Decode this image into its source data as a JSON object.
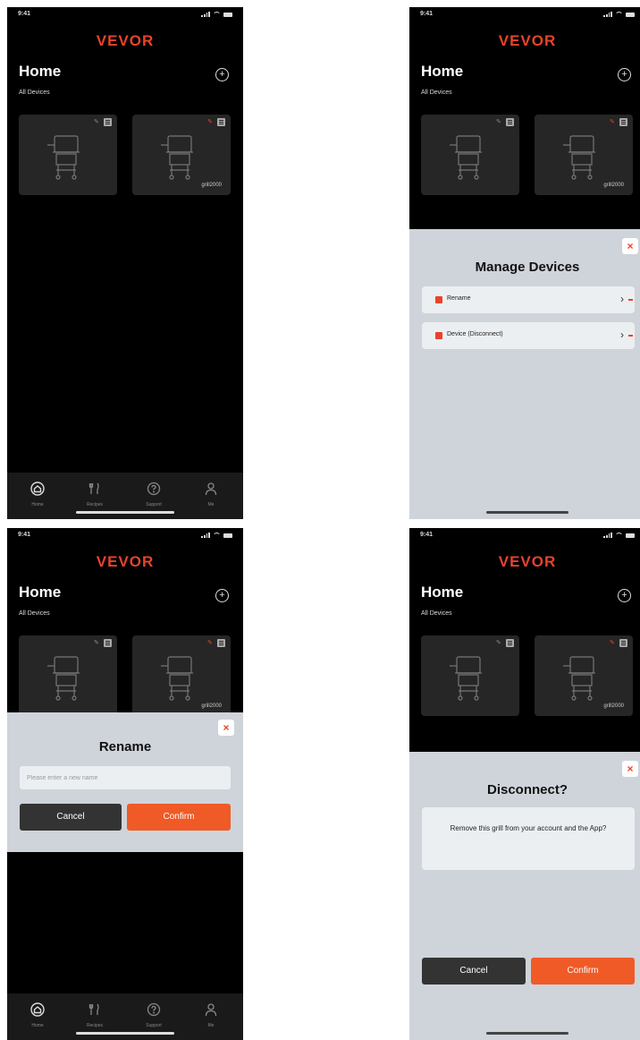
{
  "status": {
    "time": "9:41"
  },
  "brand": {
    "logo": "VEVOR",
    "accent": "#e8432b",
    "button": "#ef5a27"
  },
  "home": {
    "title": "Home",
    "subtitle": "All Devices",
    "add_icon": "plus-circle-icon",
    "devices": [
      {
        "name": ""
      },
      {
        "name": "grill2000"
      }
    ]
  },
  "tabs": [
    {
      "label": "Home",
      "icon": "home-icon"
    },
    {
      "label": "Recipes",
      "icon": "fork-knife-icon"
    },
    {
      "label": "Support",
      "icon": "help-icon"
    },
    {
      "label": "Me",
      "icon": "user-icon"
    }
  ],
  "manage": {
    "title": "Manage Devices",
    "items": [
      {
        "label": "Rename"
      },
      {
        "label": "Device (Disconnect)"
      }
    ]
  },
  "rename": {
    "title": "Rename",
    "placeholder": "Please enter a new name",
    "cancel": "Cancel",
    "confirm": "Confirm"
  },
  "disconnect": {
    "title": "Disconnect?",
    "message": "Remove this grill from your account and the App?",
    "cancel": "Cancel",
    "confirm": "Confirm"
  }
}
